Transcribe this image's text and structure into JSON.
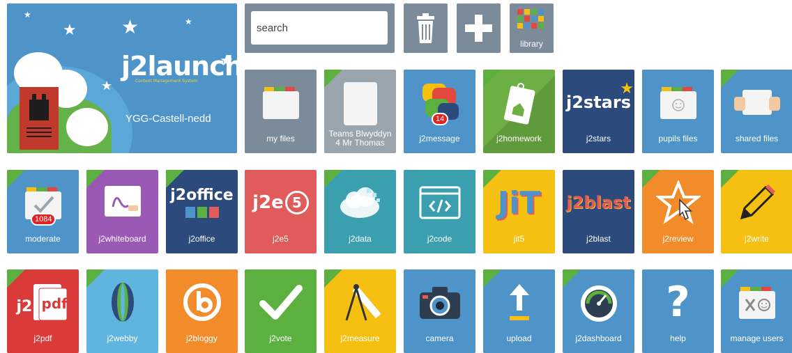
{
  "banner": {
    "title": "j2launch",
    "subtitle": "Content Management System",
    "school": "YGG-Castell-nedd"
  },
  "search": {
    "placeholder": "search"
  },
  "toolbar": {
    "trash_icon": "trash-icon",
    "add_icon": "plus-icon",
    "library_label": "library"
  },
  "badges": {
    "j2message": "14",
    "moderate": "1084"
  },
  "tiles": {
    "my_files": "my files",
    "teams_line1": "Teams Blwyddyn",
    "teams_line2": "4 Mr Thomas",
    "j2message": "j2message",
    "j2homework": "j2homework",
    "j2stars": "j2stars",
    "pupils_files": "pupils files",
    "shared_files": "shared files",
    "moderate": "moderate",
    "j2whiteboard": "j2whiteboard",
    "j2office": "j2office",
    "j2e5": "j2e5",
    "j2data": "j2data",
    "j2code": "j2code",
    "jit5": "jit5",
    "j2blast": "j2blast",
    "j2review": "j2review",
    "j2write": "j2write",
    "j2pdf": "j2pdf",
    "j2webby": "j2webby",
    "j2bloggy": "j2bloggy",
    "j2vote": "j2vote",
    "j2measure": "j2measure",
    "camera": "camera",
    "upload": "upload",
    "j2dashboard": "j2dashboard",
    "help": "help",
    "manage_users": "manage users"
  },
  "logo_text": {
    "j2stars": "j2stars",
    "j2office": "j2office",
    "j2e5": "j2e",
    "j2e5_num": "5",
    "jit": "JiT",
    "j2blast": "j2blast",
    "j2pdf_j2": "j2",
    "j2pdf_pdf": "pdf",
    "help": "?"
  },
  "colors": {
    "grey": "#7c8b99",
    "blue": "#4f94c8",
    "green": "#5cb040",
    "red": "#e25b5b",
    "yellow": "#f5c012",
    "purple": "#9b59b6",
    "navy": "#2c4a7c",
    "orange": "#f28c2b",
    "teal": "#3aa0b0"
  }
}
